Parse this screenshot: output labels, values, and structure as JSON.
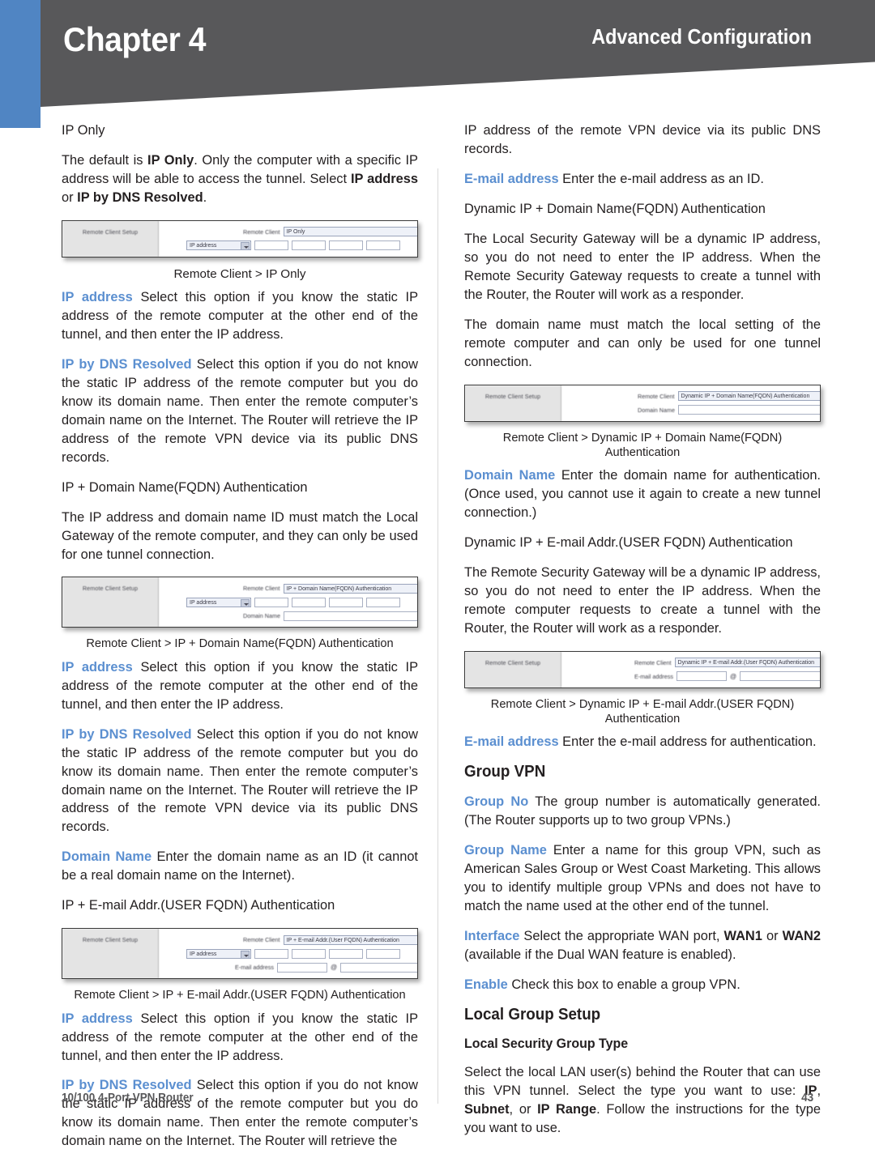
{
  "header": {
    "chapter": "Chapter 4",
    "section": "Advanced Configuration",
    "blue_accent": "#5085c3",
    "band_color": "#58585a"
  },
  "accent_term_color": "#5b8fd0",
  "left_column": {
    "heading_ip_only": "IP Only",
    "para_default": {
      "t1": "The default is ",
      "b1": "IP Only",
      "t2": ". Only the computer with a specific IP address will be able to access the tunnel. Select ",
      "b2": "IP address",
      "t3": " or ",
      "b3": "IP by DNS Resolved",
      "t4": "."
    },
    "figure1": {
      "panel_label": "Remote Client Setup",
      "row1_label": "Remote Client",
      "row1_value": "IP Only",
      "row2_select": "IP address",
      "caption": "Remote Client > IP Only"
    },
    "para_ip_address_1": {
      "term": "IP address",
      "text": "Select this option if you know the static IP address of the remote computer at the other end of the tunnel, and then enter the IP address."
    },
    "para_dns_resolved_1": {
      "term": "IP by DNS Resolved",
      "text": "Select this option if you do not know the static IP address of the remote computer but you do know its domain name. Then enter the remote computer’s domain name on the Internet. The Router will retrieve the IP address of the remote VPN device via its public DNS records."
    },
    "heading_ip_fqdn": "IP + Domain Name(FQDN) Authentication",
    "para_ip_fqdn": "The IP address and domain name ID must match the Local Gateway of the remote computer, and they can only be used for one tunnel connection.",
    "figure2": {
      "panel_label": "Remote Client Setup",
      "row1_label": "Remote Client",
      "row1_value": "IP + Domain Name(FQDN) Authentication",
      "row2_select": "IP address",
      "row3_label": "Domain Name",
      "caption": "Remote Client > IP + Domain Name(FQDN) Authentication"
    },
    "para_ip_address_2": {
      "term": "IP address",
      "text": "Select this option if you know the static IP address of the remote computer at the other end of the tunnel, and then enter the IP address."
    },
    "para_dns_resolved_2": {
      "term": "IP by DNS Resolved",
      "text": "Select this option if you do not know the static IP address of the remote computer but you do know its domain name. Then enter the remote computer’s domain name on the Internet. The Router will retrieve the IP address of the remote VPN device via its public DNS records."
    },
    "para_domain_name": {
      "term": "Domain Name",
      "text": "Enter the domain name as an ID (it cannot be a real domain name on the Internet)."
    },
    "heading_ip_email": "IP + E-mail Addr.(USER FQDN) Authentication",
    "figure3": {
      "panel_label": "Remote Client Setup",
      "row1_label": "Remote Client",
      "row1_value": "IP + E-mail Addr.(User FQDN) Authentication",
      "row2_select": "IP address",
      "row3_label": "E-mail address",
      "row3_at": "@",
      "caption": "Remote Client > IP + E-mail Addr.(USER FQDN) Authentication"
    },
    "para_ip_address_3": {
      "term": "IP address",
      "text": "Select this option if you know the static IP address of the remote computer at the other end of the tunnel, and then enter the IP address."
    },
    "para_dns_resolved_3": {
      "term": "IP by DNS Resolved",
      "text": "Select this option if you do not know the static IP address of the remote computer but you do know its domain name. Then enter the remote computer’s domain name on the Internet. The Router will retrieve the"
    }
  },
  "right_column": {
    "para_continued": "IP address of the remote VPN device via its public DNS records.",
    "para_email_address_1": {
      "term": "E-mail address",
      "text": "Enter the e-mail address as an ID."
    },
    "heading_dyn_fqdn": "Dynamic IP + Domain Name(FQDN) Authentication",
    "para_dyn_fqdn_1": "The Local Security Gateway will be a dynamic IP address, so you do not need to enter the IP address. When the Remote Security Gateway requests to create a tunnel with the Router, the Router will work as a responder.",
    "para_dyn_fqdn_2": "The domain name must match the local setting of the remote computer and can only be used for one tunnel connection.",
    "figure4": {
      "panel_label": "Remote Client Setup",
      "row1_label": "Remote Client",
      "row1_value": "Dynamic IP + Domain Name(FQDN) Authentication",
      "row2_label": "Domain Name",
      "caption": "Remote Client > Dynamic IP + Domain Name(FQDN) Authentication"
    },
    "para_domain_name_2": {
      "term": "Domain Name",
      "text": "Enter the domain name for authentication. (Once used, you cannot use it again to create a new tunnel connection.)"
    },
    "heading_dyn_email": "Dynamic IP + E-mail Addr.(USER FQDN) Authentication",
    "para_dyn_email": "The Remote Security Gateway will be a dynamic IP address, so you do not need to enter the IP address. When the remote computer requests to create a tunnel with the Router, the Router will work as a responder.",
    "figure5": {
      "panel_label": "Remote Client Setup",
      "row1_label": "Remote Client",
      "row1_value": "Dynamic IP + E-mail Addr.(User FQDN) Authentication",
      "row2_label": "E-mail address",
      "row2_at": "@",
      "caption": "Remote Client > Dynamic IP + E-mail Addr.(USER FQDN) Authentication"
    },
    "para_email_address_2": {
      "term": "E-mail address",
      "text": "Enter the e-mail address for authentication."
    },
    "heading_group_vpn": "Group VPN",
    "para_group_no": {
      "term": "Group No",
      "text": "The group number is automatically generated. (The Router supports up to two group VPNs.)"
    },
    "para_group_name": {
      "term": "Group Name",
      "text": "Enter a name for this group VPN, such as American Sales Group or West Coast Marketing. This allows you to identify multiple group VPNs and does not have to match the name used at the other end of the tunnel."
    },
    "para_interface": {
      "term": "Interface",
      "t1": "Select the appropriate WAN port, ",
      "b1": "WAN1",
      "t2": " or ",
      "b2": "WAN2",
      "t3": " (available if the Dual WAN feature is enabled)."
    },
    "para_enable": {
      "term": "Enable",
      "text": "Check this box to enable a group VPN."
    },
    "heading_local_group_setup": "Local Group Setup",
    "heading_local_security_group_type": "Local Security Group Type",
    "para_local_security": {
      "t1": "Select the local LAN user(s) behind the Router that can use this VPN tunnel. Select the type you want to use: ",
      "b1": "IP",
      "t2": ", ",
      "b2": "Subnet",
      "t3": ", or ",
      "b3": "IP Range",
      "t4": ". Follow the instructions for the type you want to use."
    }
  },
  "footer": {
    "product": "10/100 4-Port VPN Router",
    "page_number": "43"
  }
}
